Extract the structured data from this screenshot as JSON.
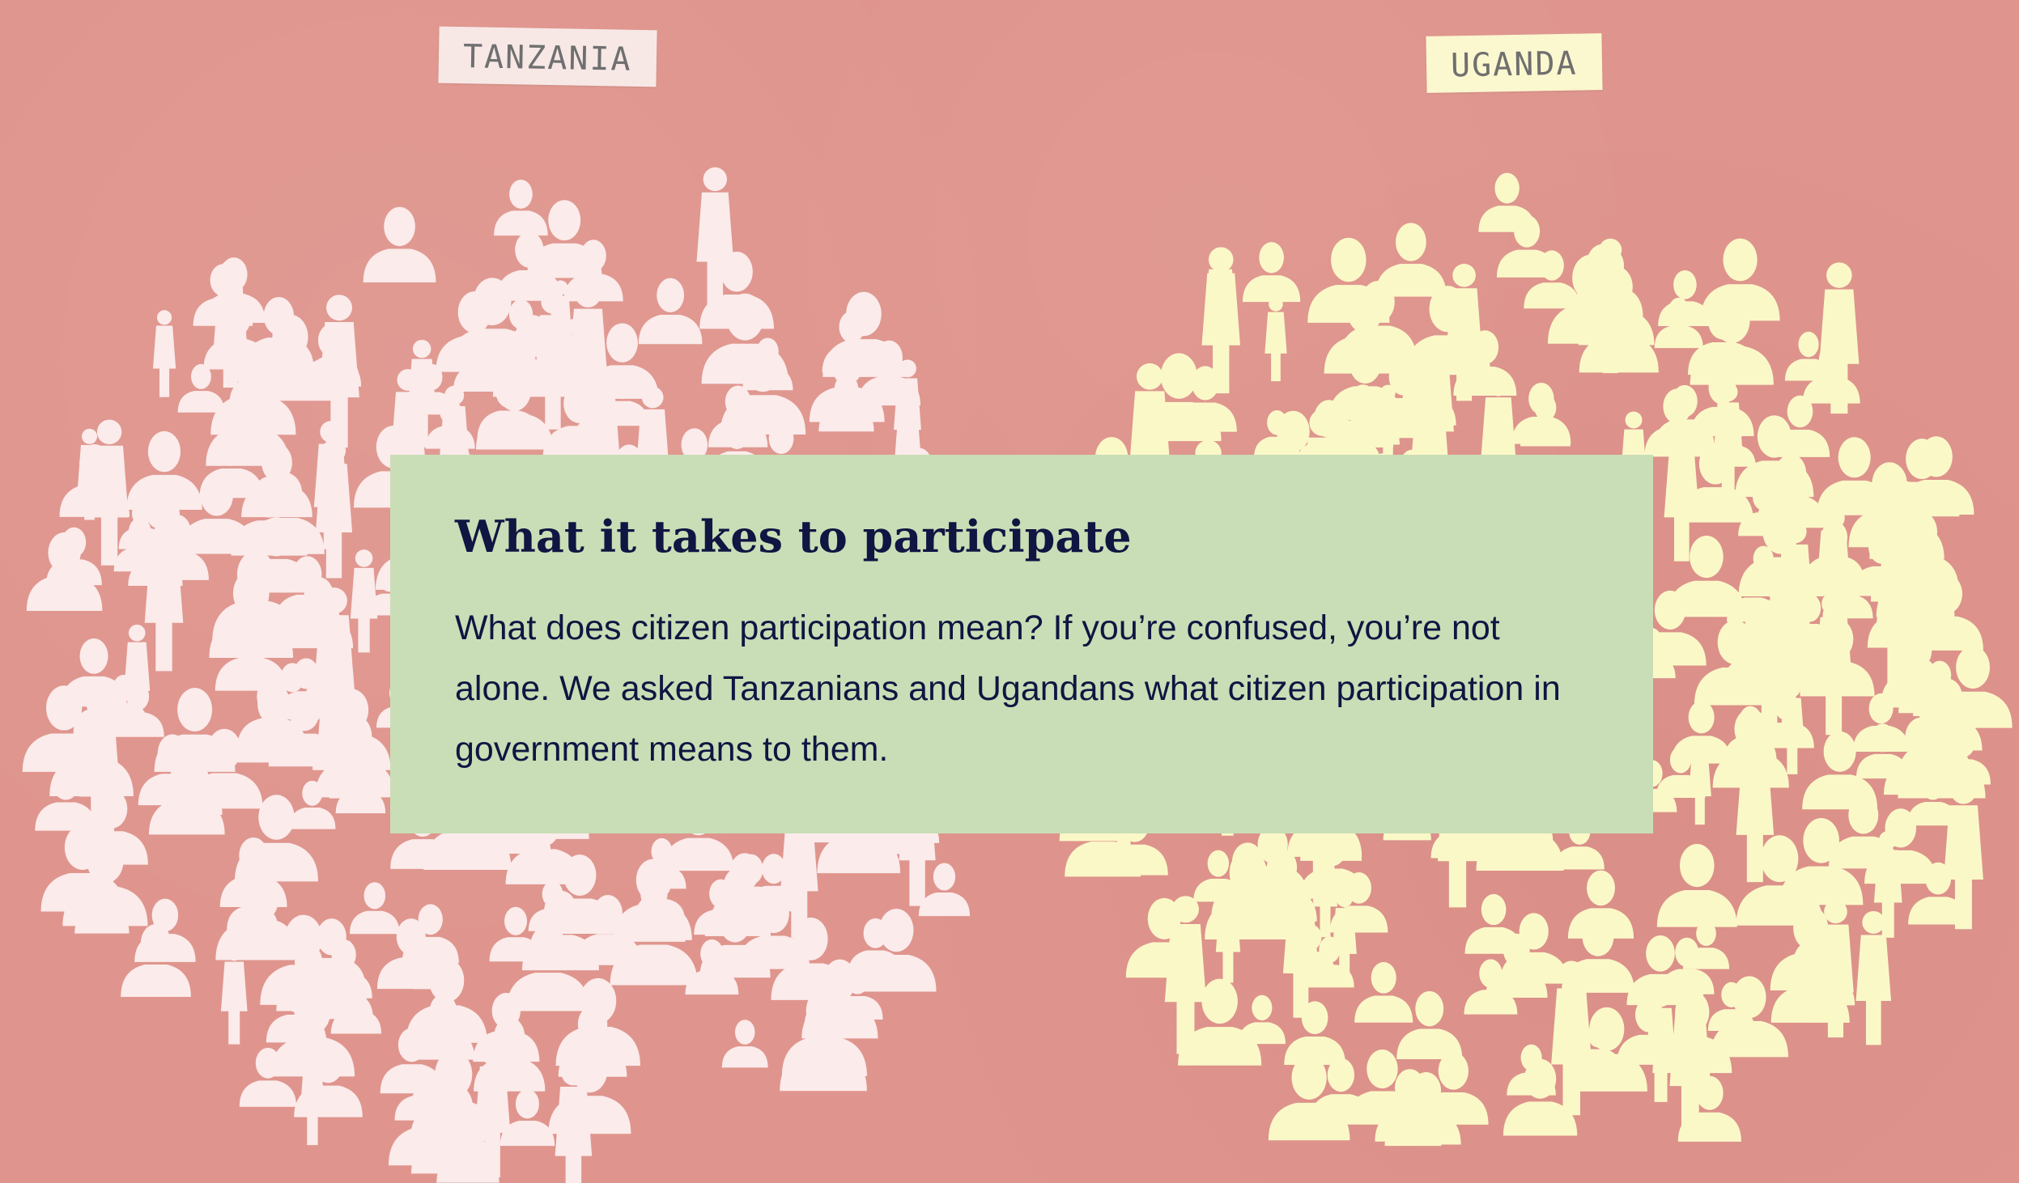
{
  "labels": {
    "left": "TANZANIA",
    "right": "UGANDA"
  },
  "card": {
    "title": "What it takes to participate",
    "body": "What does citizen participation mean? If you’re confused, you’re not alone. We asked Tanzanians and Ugandans what citizen participation in government means to them."
  },
  "colors": {
    "background": "#df958d",
    "left_crowd": "#fbebeb",
    "right_crowd": "#fbf8c8",
    "card": "#c9deb6",
    "text": "#101542"
  }
}
